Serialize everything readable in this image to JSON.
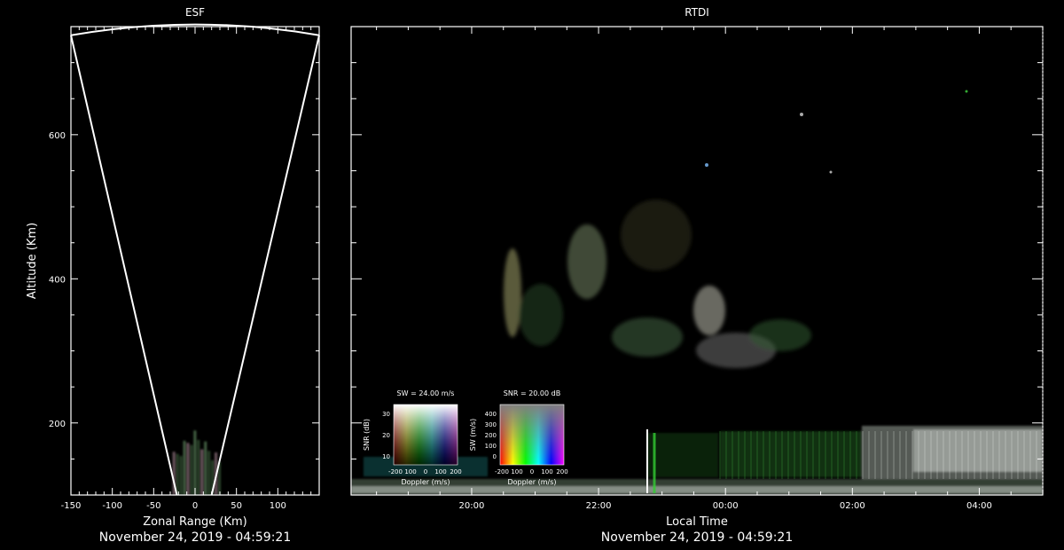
{
  "chart_data": [
    {
      "panel": "esf",
      "type": "scatter",
      "title": "ESF",
      "xlabel": "Zonal Range (Km)",
      "ylabel": "Altitude (Km)",
      "xlim": [
        -150,
        150
      ],
      "ylim": [
        100,
        750
      ],
      "xticks": [
        -150,
        -100,
        -50,
        0,
        50,
        100
      ],
      "yticks": [
        200,
        400,
        600
      ],
      "footer": "November 24, 2019 - 04:59:21",
      "beam_outline": {
        "apex": [
          0,
          100
        ],
        "left_edge_top": [
          -150,
          738
        ],
        "right_edge_top": [
          150,
          738
        ],
        "arc_top_altitude": 753
      },
      "echo_region": {
        "x_range": [
          -25,
          30
        ],
        "alt_range": [
          100,
          190
        ]
      }
    },
    {
      "panel": "rtdi",
      "type": "heatmap",
      "title": "RTDI",
      "xlabel": "Local Time",
      "ylabel": "",
      "xlim_hours": [
        18.1,
        29.0
      ],
      "ylim": [
        100,
        750
      ],
      "xticks": [
        "20:00",
        "22:00",
        "00:00",
        "02:00",
        "04:00"
      ],
      "xtick_hours": [
        20,
        22,
        24,
        26,
        28
      ],
      "footer": "November 24, 2019 - 04:59:21",
      "legends": [
        {
          "title": "SW = 24.00 m/s",
          "xlabel": "Doppler (m/s)",
          "ylabel": "SNR (dB)",
          "xticks": [
            "-200",
            "100",
            "0",
            "100",
            "200"
          ],
          "yticks": [
            "30",
            "20",
            "10"
          ]
        },
        {
          "title": "SNR = 20.00 dB",
          "xlabel": "Doppler (m/s)",
          "ylabel": "SW (m/s)",
          "xticks": [
            "-200",
            "100",
            "0",
            "100",
            "200"
          ],
          "yticks": [
            "400",
            "300",
            "200",
            "100",
            "0"
          ]
        }
      ]
    }
  ],
  "colors": {
    "background": "#000000",
    "axis": "#ffffff"
  }
}
